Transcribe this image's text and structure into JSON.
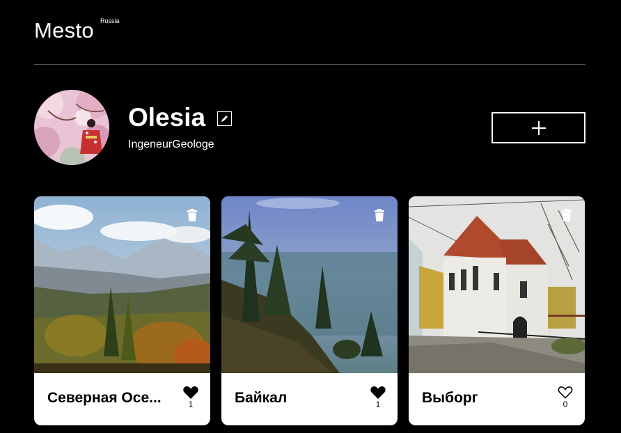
{
  "header": {
    "logo": "Mesto",
    "logo_sup": "Russia"
  },
  "profile": {
    "name": "Olesia",
    "about": "IngeneurGeologe"
  },
  "cards": [
    {
      "title": "Северная Осе...",
      "likes": "1",
      "liked": true
    },
    {
      "title": "Байкал",
      "likes": "1",
      "liked": true
    },
    {
      "title": "Выборг",
      "likes": "0",
      "liked": false
    }
  ],
  "colors": {
    "background": "#000000",
    "card": "#ffffff",
    "divider": "#545454"
  },
  "icons": {
    "edit": "pencil-icon",
    "add": "plus-icon",
    "delete": "trash-icon",
    "like": "heart-icon"
  }
}
